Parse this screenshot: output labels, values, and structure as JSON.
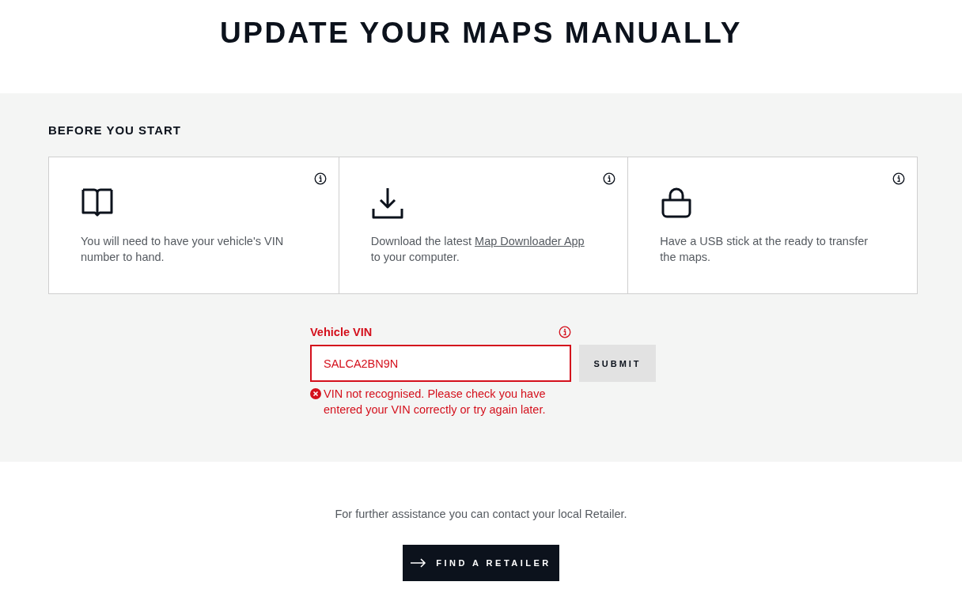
{
  "heading": "UPDATE YOUR MAPS MANUALLY",
  "before_you_start": {
    "title": "BEFORE YOU START",
    "cards": [
      {
        "kind": "book",
        "text": "You will need to have your vehicle's VIN number to hand."
      },
      {
        "kind": "download",
        "text": "Download the latest ",
        "link": "Map Downloader App",
        "text_after": " to your computer."
      },
      {
        "kind": "bag",
        "text": "Have a USB stick at the ready to transfer the maps."
      }
    ]
  },
  "vin_form": {
    "label": "Vehicle VIN",
    "value": "SALCA2BN9N",
    "error": true,
    "error_message": "VIN not recognised. Please check you have entered your VIN correctly or try again later.",
    "submit": "SUBMIT"
  },
  "footer": {
    "text": "For further assistance you can contact your local Retailer.",
    "button": "FIND A RETAILER"
  }
}
